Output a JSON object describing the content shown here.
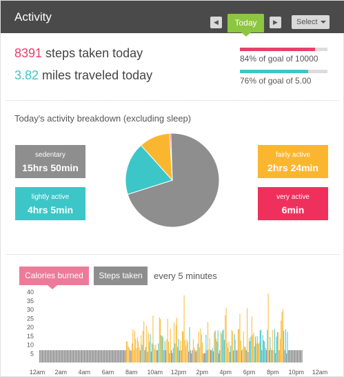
{
  "header": {
    "title": "Activity",
    "today_label": "Today",
    "prev_icon": "◀",
    "next_icon": "▶",
    "select_label": "Select"
  },
  "summary": {
    "steps_value": "8391",
    "steps_text": " steps taken today",
    "miles_value": "3.82",
    "miles_text": " miles traveled today",
    "steps_goal_label": "84% of goal of 10000",
    "steps_goal_fraction": 0.86,
    "miles_goal_label": "76% of goal of 5.00",
    "miles_goal_fraction": 0.78
  },
  "breakdown": {
    "title": "Today's activity breakdown (excluding sleep)",
    "sedentary": {
      "label": "sedentary",
      "value": "15hrs 50min",
      "minutes": 950
    },
    "lightly_active": {
      "label": "lightly active",
      "value": "4hrs 5min",
      "minutes": 245
    },
    "fairly_active": {
      "label": "fairly active",
      "value": "2hrs 24min",
      "minutes": 144
    },
    "very_active": {
      "label": "very active",
      "value": "6min",
      "minutes": 6
    }
  },
  "colors": {
    "header_bg": "#4a4a4a",
    "today_green": "#8dc63f",
    "pink": "#e8406a",
    "teal": "#3cc6c8",
    "sedentary": "#8e8e8e",
    "fairly": "#fbb630",
    "very": "#f0305c",
    "calories_tab": "#ec7b9a"
  },
  "chart_tabs": {
    "calories": "Calories burned",
    "steps": "Steps taken",
    "interval": "every 5 minutes"
  },
  "chart_data": {
    "type": "bar",
    "ylim": [
      0,
      40
    ],
    "yticks": [
      "5",
      "10",
      "15",
      "20",
      "25",
      "30",
      "35",
      "40"
    ],
    "xticks": [
      "12am",
      "2am",
      "4am",
      "6am",
      "8am",
      "10am",
      "12pm",
      "2pm",
      "4pm",
      "6pm",
      "8pm",
      "10pm",
      "12am"
    ],
    "baseline_value": 7,
    "series": [
      {
        "values": []
      }
    ]
  }
}
